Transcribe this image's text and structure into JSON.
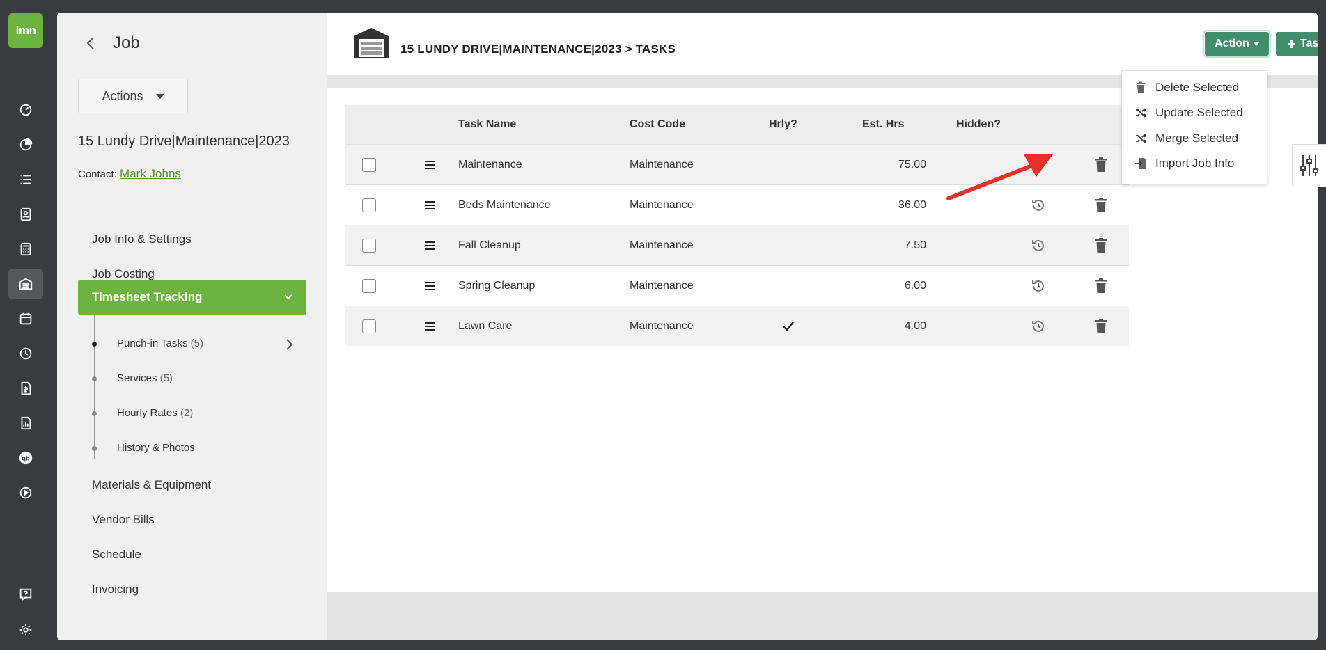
{
  "app": {
    "logo_text": "lmn",
    "brand_color": "#6db33f",
    "accent_color": "#3f8f6b"
  },
  "rail": {
    "items": [
      "dashboard-icon",
      "pie-chart-icon",
      "list-icon",
      "contacts-icon",
      "calculator-icon",
      "jobs-icon",
      "calendar-icon",
      "clock-icon",
      "invoice-icon",
      "report-icon",
      "quickbooks-icon",
      "play-icon"
    ],
    "bottom": [
      "help-icon",
      "settings-icon"
    ]
  },
  "side": {
    "title": "Job",
    "actions_label": "Actions",
    "job_name": "15 Lundy Drive|Maintenance|2023",
    "contact_label": "Contact:",
    "contact_name": "Mark Johns",
    "nav": {
      "job_info": "Job Info & Settings",
      "job_costing": "Job Costing",
      "timesheet": "Timesheet Tracking",
      "materials": "Materials & Equipment",
      "vendor_bills": "Vendor Bills",
      "schedule": "Schedule",
      "invoicing": "Invoicing"
    },
    "sub": [
      {
        "label": "Punch-in Tasks",
        "count": "(5)"
      },
      {
        "label": "Services",
        "count": "(5)"
      },
      {
        "label": "Hourly Rates",
        "count": "(2)"
      },
      {
        "label": "History & Photos",
        "count": ""
      }
    ]
  },
  "header": {
    "title": "15 LUNDY DRIVE|MAINTENANCE|2023 > TASKS",
    "action_label": "Action",
    "task_label": "Task"
  },
  "table": {
    "columns": [
      "Task Name",
      "Cost Code",
      "Hrly?",
      "Est. Hrs",
      "Hidden?"
    ],
    "rows": [
      {
        "name": "Maintenance",
        "cost_code": "Maintenance",
        "hourly": false,
        "est_hrs": "75.00"
      },
      {
        "name": "Beds Maintenance",
        "cost_code": "Maintenance",
        "hourly": false,
        "est_hrs": "36.00"
      },
      {
        "name": "Fall Cleanup",
        "cost_code": "Maintenance",
        "hourly": false,
        "est_hrs": "7.50"
      },
      {
        "name": "Spring Cleanup",
        "cost_code": "Maintenance",
        "hourly": false,
        "est_hrs": "6.00"
      },
      {
        "name": "Lawn Care",
        "cost_code": "Maintenance",
        "hourly": true,
        "est_hrs": "4.00"
      }
    ]
  },
  "dropdown": {
    "items": [
      "Delete Selected",
      "Update Selected",
      "Merge Selected",
      "Import Job Info"
    ]
  }
}
